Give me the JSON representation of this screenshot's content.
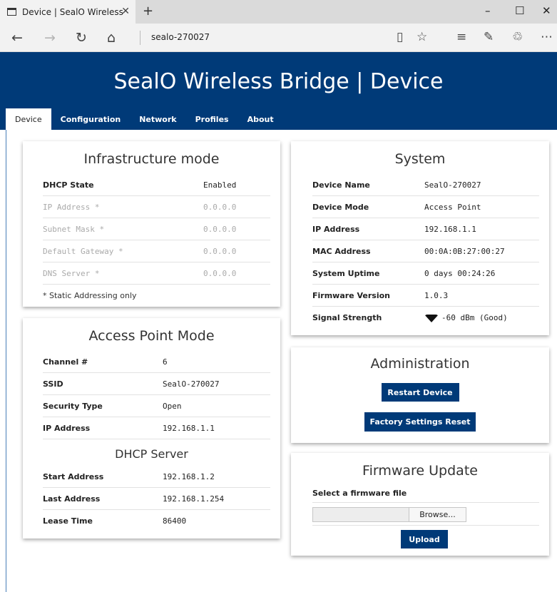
{
  "browser": {
    "tab_title": "Device | SealO Wireless",
    "url": "sealo-270027"
  },
  "banner": {
    "title": "SealO Wireless Bridge | Device"
  },
  "nav": {
    "tabs": [
      "Device",
      "Configuration",
      "Network",
      "Profiles",
      "About"
    ],
    "active": "Device"
  },
  "infrastructure": {
    "title": "Infrastructure mode",
    "rows": [
      {
        "label": "DHCP State",
        "value": "Enabled",
        "dim": false
      },
      {
        "label": "IP Address *",
        "value": "0.0.0.0",
        "dim": true
      },
      {
        "label": "Subnet Mask *",
        "value": "0.0.0.0",
        "dim": true
      },
      {
        "label": "Default Gateway *",
        "value": "0.0.0.0",
        "dim": true
      },
      {
        "label": "DNS Server *",
        "value": "0.0.0.0",
        "dim": true
      }
    ],
    "note": "* Static Addressing only"
  },
  "access_point": {
    "title": "Access Point Mode",
    "rows": [
      {
        "label": "Channel #",
        "value": "6"
      },
      {
        "label": "SSID",
        "value": "SealO-270027"
      },
      {
        "label": "Security Type",
        "value": "Open"
      },
      {
        "label": "IP Address",
        "value": "192.168.1.1"
      }
    ],
    "dhcp_title": "DHCP Server",
    "dhcp_rows": [
      {
        "label": "Start Address",
        "value": "192.168.1.2"
      },
      {
        "label": "Last Address",
        "value": "192.168.1.254"
      },
      {
        "label": "Lease Time",
        "value": "86400"
      }
    ]
  },
  "system": {
    "title": "System",
    "rows": [
      {
        "label": "Device Name",
        "value": "SealO-270027"
      },
      {
        "label": "Device Mode",
        "value": "Access Point"
      },
      {
        "label": "IP Address",
        "value": "192.168.1.1"
      },
      {
        "label": "MAC Address",
        "value": "00:0A:0B:27:00:27"
      },
      {
        "label": "System Uptime",
        "value": "0 days 00:24:26"
      },
      {
        "label": "Firmware Version",
        "value": "1.0.3"
      }
    ],
    "signal_label": "Signal Strength",
    "signal_value": "-60 dBm (Good)",
    "signal_icon": "wifi-signal-icon"
  },
  "administration": {
    "title": "Administration",
    "restart_label": "Restart Device",
    "reset_label": "Factory Settings Reset"
  },
  "firmware": {
    "title": "Firmware Update",
    "select_label": "Select a firmware file",
    "browse_label": "Browse...",
    "upload_label": "Upload"
  },
  "colors": {
    "brand": "#003a78",
    "dim_text": "#aaaaaa"
  }
}
